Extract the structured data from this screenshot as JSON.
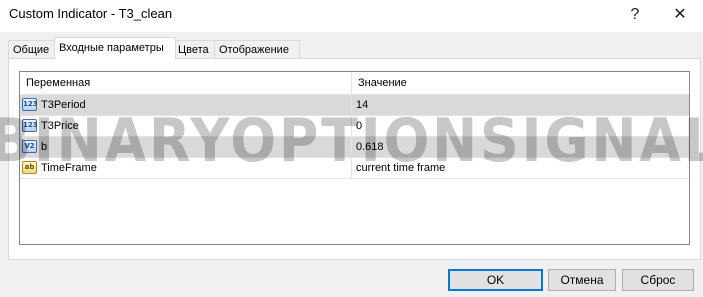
{
  "window": {
    "title": "Custom Indicator - T3_clean",
    "help_icon": "?",
    "close_icon": "✕"
  },
  "tabs": [
    {
      "label": "Общие",
      "active": false
    },
    {
      "label": "Входные параметры",
      "active": true
    },
    {
      "label": "Цвета",
      "active": false
    },
    {
      "label": "Отображение",
      "active": false
    }
  ],
  "table": {
    "columns": [
      "Переменная",
      "Значение"
    ],
    "rows": [
      {
        "icon": "123",
        "icon_name": "integer-icon",
        "name": "T3Period",
        "value": "14"
      },
      {
        "icon": "123",
        "icon_name": "integer-icon",
        "name": "T3Price",
        "value": "0"
      },
      {
        "icon": "V2",
        "icon_name": "double-icon",
        "name": "b",
        "value": "0.618"
      },
      {
        "icon": "ab",
        "icon_name": "string-icon",
        "name": "TimeFrame",
        "value": "current time frame"
      }
    ]
  },
  "watermark": "BINARYOPTIONSIGNALS.COM",
  "buttons": {
    "ok": "OK",
    "cancel": "Отмена",
    "reset": "Сброс"
  }
}
